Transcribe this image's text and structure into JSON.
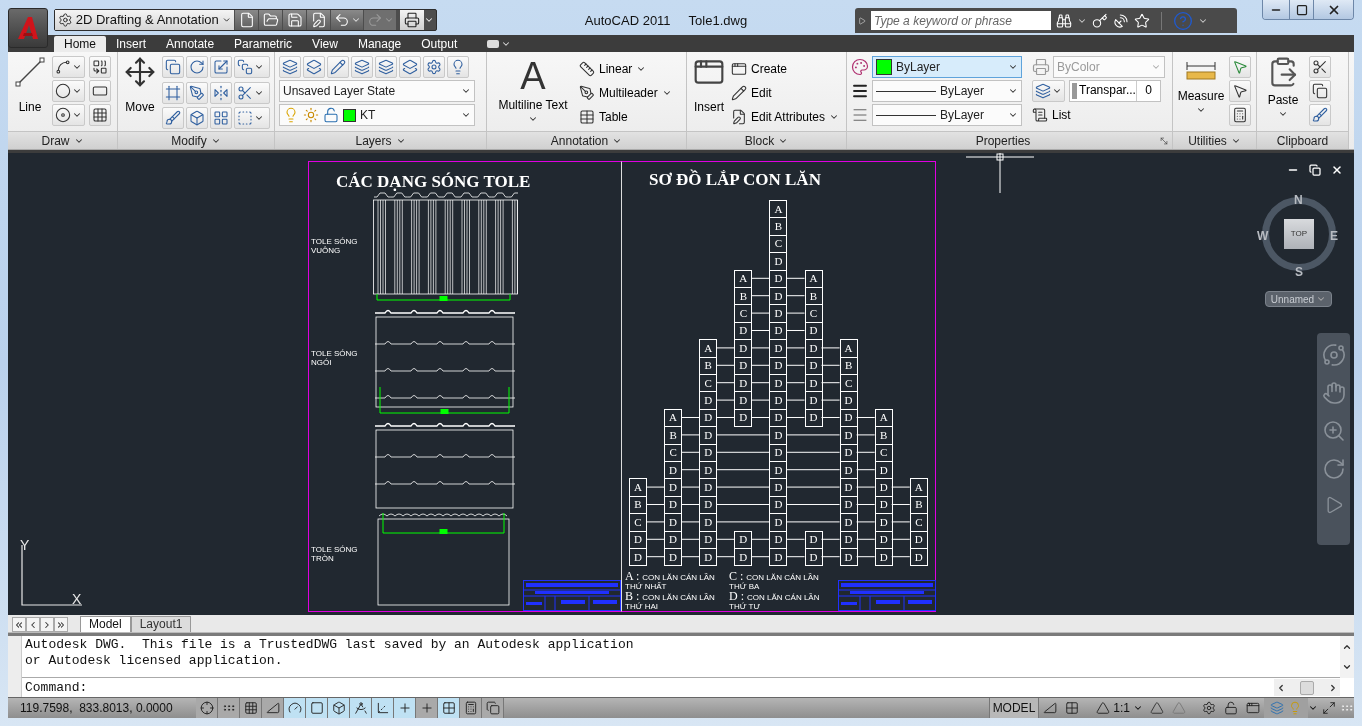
{
  "title_bar": {
    "workspace": "2D Drafting & Annotation",
    "app_name": "AutoCAD 2011",
    "file_name": "Tole1.dwg",
    "search": {
      "placeholder": "Type a keyword or phrase"
    },
    "redo": {
      "disabled": true
    }
  },
  "ribbon": {
    "tabs": [
      {
        "label": "Home",
        "selected": true
      },
      {
        "label": "Insert",
        "selected": false
      },
      {
        "label": "Annotate",
        "selected": false
      },
      {
        "label": "Parametric",
        "selected": false
      },
      {
        "label": "View",
        "selected": false
      },
      {
        "label": "Manage",
        "selected": false
      },
      {
        "label": "Output",
        "selected": false
      }
    ],
    "panels": {
      "draw": {
        "title": "Draw",
        "line": "Line"
      },
      "modify": {
        "title": "Modify",
        "move": "Move"
      },
      "layers": {
        "title": "Layers",
        "layer_state": "Unsaved Layer State",
        "layer": {
          "name": "KT",
          "color": "#00ff00",
          "on": true,
          "frozen": false,
          "locked": false
        }
      },
      "annotation": {
        "title": "Annotation",
        "mtext": {
          "glyph": "A",
          "label": "Multiline Text"
        },
        "tools": [
          "Linear",
          "Multileader",
          "Table"
        ]
      },
      "block": {
        "title": "Block",
        "insert": "Insert",
        "tools": [
          "Create",
          "Edit",
          "Edit Attributes"
        ]
      },
      "properties": {
        "title": "Properties",
        "color": {
          "value": "ByLayer",
          "color": "#00ff00"
        },
        "lineweight": "ByLayer",
        "linetype": "ByLayer",
        "plot_style": {
          "value": "ByColor",
          "disabled": true
        },
        "transparency": {
          "label": "Transpar...",
          "value": "0"
        },
        "list": "List"
      },
      "utilities": {
        "title": "Utilities",
        "measure": "Measure"
      },
      "clipboard": {
        "title": "Clipboard",
        "paste": "Paste"
      }
    }
  },
  "drawing": {
    "profiles_sheet": {
      "title": "CÁC DẠNG SÓNG TOLE",
      "profiles": [
        {
          "kind": "square",
          "label": "TOLE SÓNG VUÔNG",
          "marked": true
        },
        {
          "kind": "tile",
          "label": "TOLE SÓNG NGÓI",
          "marked": true
        },
        {
          "kind": "tile",
          "marked": false
        },
        {
          "kind": "round",
          "label": "TOLE SÓNG TRÒN",
          "marked": true
        }
      ]
    },
    "roller_sheet": {
      "title": "SƠ ĐỒ LẮP CON LĂN",
      "columns": [
        {
          "cells": [
            null,
            null,
            null,
            null,
            null,
            null,
            null,
            null,
            null,
            null,
            null,
            null,
            null,
            null,
            null,
            null,
            "A",
            "B",
            "C",
            "D",
            "D"
          ]
        },
        {
          "cells": [
            null,
            null,
            null,
            null,
            null,
            null,
            null,
            null,
            null,
            null,
            null,
            null,
            "A",
            "B",
            "C",
            "D",
            "D",
            "D",
            "D",
            "D",
            "D"
          ]
        },
        {
          "cells": [
            null,
            null,
            null,
            null,
            null,
            null,
            null,
            null,
            "A",
            "B",
            "C",
            "D",
            "D",
            "D",
            "D",
            "D",
            "D",
            "D",
            "D",
            "D",
            "D"
          ]
        },
        {
          "cells": [
            null,
            null,
            null,
            null,
            "A",
            "B",
            "C",
            "D",
            "D",
            "D",
            "D",
            "D",
            "D",
            null,
            null,
            null,
            null,
            null,
            null,
            "D",
            "D"
          ]
        },
        {
          "cells": [
            "A",
            "B",
            "C",
            "D",
            "D",
            "D",
            "D",
            "D",
            "D",
            "D",
            "D",
            "D",
            "D",
            "D",
            "D",
            "D",
            "D",
            "D",
            "D",
            "D",
            "D"
          ]
        },
        {
          "cells": [
            null,
            null,
            null,
            null,
            "A",
            "B",
            "C",
            "D",
            "D",
            "D",
            "D",
            "D",
            "D",
            null,
            null,
            null,
            null,
            null,
            null,
            "D",
            "D"
          ]
        },
        {
          "cells": [
            null,
            null,
            null,
            null,
            null,
            null,
            null,
            null,
            "A",
            "B",
            "C",
            "D",
            "D",
            "D",
            "D",
            "D",
            "D",
            "D",
            "D",
            "D",
            "D"
          ]
        },
        {
          "cells": [
            null,
            null,
            null,
            null,
            null,
            null,
            null,
            null,
            null,
            null,
            null,
            null,
            "A",
            "B",
            "C",
            "D",
            "D",
            "D",
            "D",
            "D",
            "D"
          ]
        },
        {
          "cells": [
            null,
            null,
            null,
            null,
            null,
            null,
            null,
            null,
            null,
            null,
            null,
            null,
            null,
            null,
            null,
            null,
            "A",
            "B",
            "C",
            "D",
            "D"
          ]
        }
      ],
      "legend": [
        {
          "key": "A :",
          "text": "CON LĂN CÁN LẦN THỨ NHẤT"
        },
        {
          "key": "C :",
          "text": "CON LĂN CÁN LẦN THỨ BA"
        },
        {
          "key": "B :",
          "text": "CON LĂN CÁN LẦN THỨ HAI"
        },
        {
          "key": "D :",
          "text": "CON LĂN CÁN LẦN THỨ TƯ"
        }
      ]
    },
    "viewcube": {
      "north": "N",
      "south": "S",
      "east": "E",
      "west": "W",
      "face": "TOP",
      "view_name": "Unnamed"
    },
    "ucs": {
      "x": "X",
      "y": "Y"
    }
  },
  "layout_tabs": [
    {
      "label": "Model",
      "selected": true
    },
    {
      "label": "Layout1",
      "selected": false
    }
  ],
  "command": {
    "history": [
      "Autodesk DWG.  This file is a TrustedDWG last saved by an Autodesk application",
      "or Autodesk licensed application."
    ],
    "prompt": "Command:"
  },
  "status_bar": {
    "coordinates": "119.7598,  833.8013, 0.0000",
    "toggles": [
      {
        "on": false
      },
      {
        "on": false
      },
      {
        "on": false
      },
      {
        "on": false
      },
      {
        "on": true
      },
      {
        "on": true
      },
      {
        "on": true
      },
      {
        "on": true
      },
      {
        "on": true
      },
      {
        "on": true
      },
      {
        "on": false
      },
      {
        "on": true
      },
      {
        "on": false
      },
      {
        "on": false
      }
    ],
    "space": "MODEL",
    "annotation_scale": "1:1"
  }
}
